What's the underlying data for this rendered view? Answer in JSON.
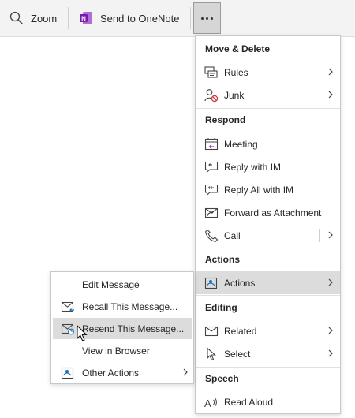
{
  "toolbar": {
    "zoom_label": "Zoom",
    "onenote_label": "Send to OneNote",
    "more_icon": "ellipsis-icon"
  },
  "menu": {
    "move_delete": {
      "header": "Move & Delete",
      "rules": "Rules",
      "junk": "Junk"
    },
    "respond": {
      "header": "Respond",
      "meeting": "Meeting",
      "reply_im": "Reply with IM",
      "reply_all_im": "Reply All with IM",
      "forward_attachment": "Forward as Attachment",
      "call": "Call"
    },
    "actions": {
      "header": "Actions",
      "actions": "Actions"
    },
    "editing": {
      "header": "Editing",
      "related": "Related",
      "select": "Select"
    },
    "speech": {
      "header": "Speech",
      "read_aloud": "Read Aloud"
    }
  },
  "submenu": {
    "edit_message": "Edit Message",
    "recall": "Recall This Message...",
    "resend": "Resend This Message...",
    "view_browser": "View in Browser",
    "other_actions": "Other Actions"
  },
  "colors": {
    "accent_blue": "#1e6fb8",
    "onenote_purple": "#7719aa",
    "junk_red": "#d13438",
    "hover_gray": "#dcdcdc"
  }
}
